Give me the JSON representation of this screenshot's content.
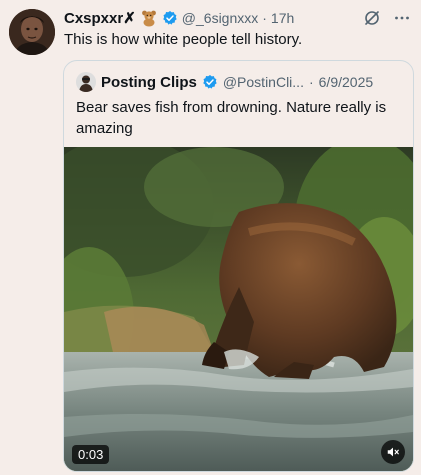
{
  "post": {
    "author_name": "Cxspxxr✗",
    "author_emoji_icon": "teddy-bear-icon",
    "verified_icon": "verified-badge-icon",
    "handle": "@_6signxxx",
    "separator": "·",
    "time": "17h",
    "text": "This is how white people tell history.",
    "actions": {
      "grok_icon": "grok-icon",
      "more_icon": "more-options-icon"
    }
  },
  "quote": {
    "author_name": "Posting Clips",
    "verified_icon": "verified-badge-icon",
    "handle": "@PostinCli...",
    "separator": "·",
    "date": "6/9/2025",
    "text": "Bear saves fish from drowning. Nature really is amazing",
    "video": {
      "timestamp": "0:03",
      "mute_icon": "speaker-muted-icon"
    }
  },
  "colors": {
    "background": "#f5ede9",
    "verified_blue": "#1d9bf0",
    "secondary_text": "#536471",
    "border": "#cfd9de"
  }
}
